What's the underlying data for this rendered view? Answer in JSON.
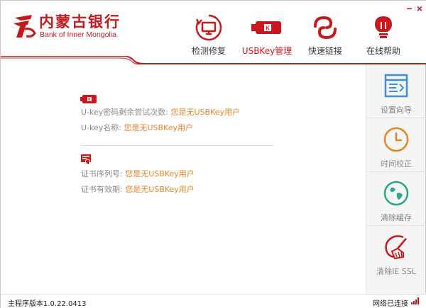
{
  "brand": {
    "name_cn": "内蒙古银行",
    "name_en": "Bank of Inner Mongolia"
  },
  "window_controls": {
    "minimize": "−",
    "close": "×"
  },
  "nav": [
    {
      "label": "检测修复",
      "icon": "monitor-refresh-icon",
      "active": false
    },
    {
      "label": "USBKey管理",
      "icon": "usbkey-icon",
      "active": true
    },
    {
      "label": "快速链接",
      "icon": "link-icon",
      "active": false
    },
    {
      "label": "在线帮助",
      "icon": "lightbulb-icon",
      "active": false
    }
  ],
  "usbkey": {
    "retry_label": "U-key密码剩余尝试次数:",
    "retry_value": "您是无USBKey用户",
    "name_label": "U-key名称:",
    "name_value": "您是无USBKey用户"
  },
  "cert": {
    "serial_label": "证书序列号:",
    "serial_value": "您是无USBKey用户",
    "validity_label": "证书有效期:",
    "validity_value": "您是无USBKey用户"
  },
  "side": [
    {
      "label": "设置向导",
      "icon": "setup-wizard-icon"
    },
    {
      "label": "时间校正",
      "icon": "clock-icon"
    },
    {
      "label": "清除缓存",
      "icon": "globe-icon"
    },
    {
      "label": "清除IE SSL",
      "icon": "broom-icon"
    }
  ],
  "status": {
    "version": "主程序版本1.0.22.0413",
    "network": "网络已连接"
  },
  "colors": {
    "brand_red": "#c8181e",
    "value_orange": "#e8842c",
    "side_blue": "#3a8fd8",
    "side_orange": "#e8842c",
    "side_teal": "#2aa888"
  }
}
